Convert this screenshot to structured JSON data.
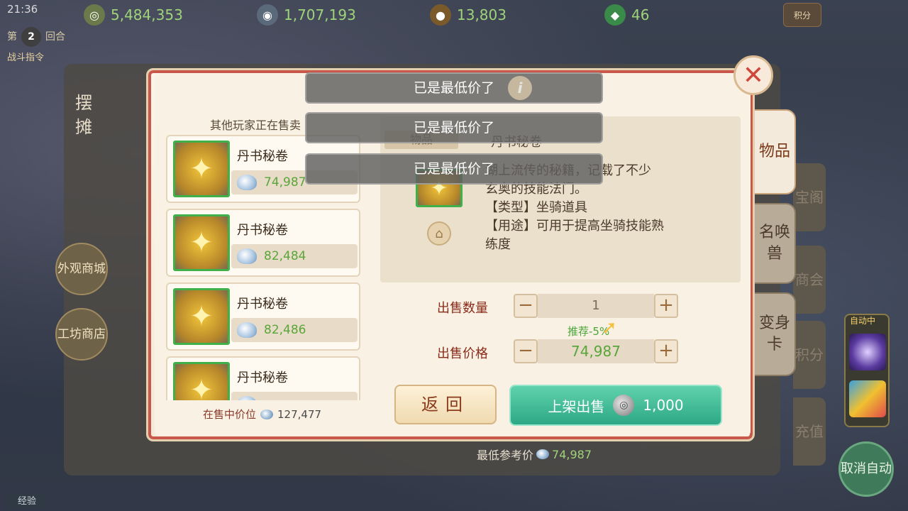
{
  "topbar": {
    "time": "21:36",
    "currency1": "5,484,353",
    "currency2": "1,707,193",
    "currency3": "13,803",
    "currency4": "46",
    "score_label": "积分"
  },
  "round": {
    "prefix": "第",
    "number": "2",
    "suffix": "回合",
    "command": "战斗指令"
  },
  "stall": {
    "title": "摆摊"
  },
  "left_buttons": {
    "appearance_mall": "外观商城",
    "workshop_store": "工坊商店"
  },
  "side_tabs": [
    {
      "label": "物品",
      "active": true
    },
    {
      "label": "召唤兽",
      "display": "名唤兽"
    },
    {
      "label": "变身卡"
    }
  ],
  "ghost_tabs": {
    "t1": "宝阁",
    "t2": "商会",
    "t3": "积分",
    "t4": "充值"
  },
  "auto": {
    "label": "自动中",
    "cancel": "取消自动"
  },
  "exp_label": "经验",
  "dialog": {
    "list_title": "其他玩家正在售卖",
    "listings": [
      {
        "name": "丹书秘卷",
        "price": "74,987"
      },
      {
        "name": "丹书秘卷",
        "price": "82,484"
      },
      {
        "name": "丹书秘卷",
        "price": "82,486"
      },
      {
        "name": "丹书秘卷",
        "price": ""
      }
    ],
    "mid_price_label": "在售中价位",
    "mid_price": "127,477",
    "detail": {
      "tag": "物品",
      "name": "丹书秘卷",
      "desc_line1": "湖上流传的秘籍，记载了不少",
      "desc_line2": "玄奥的技能法门。",
      "desc_line3": "【类型】坐骑道具",
      "desc_line4": "【用途】可用于提高坐骑技能熟",
      "desc_line5": "练度"
    },
    "qty_label": "出售数量",
    "qty_value": "1",
    "recommend": "推荐-5%",
    "price_label": "出售价格",
    "price_value": "74,987",
    "back_label": "返回",
    "sell_label": "上架出售",
    "fee": "1,000",
    "ref_label": "最低参考价",
    "ref_price": "74,987"
  },
  "toasts": [
    "已是最低价了",
    "已是最低价了",
    "已是最低价了"
  ],
  "colors": {
    "accent_green": "#2ea885",
    "price_green": "#5aa53a",
    "close_red": "#d0463c"
  }
}
